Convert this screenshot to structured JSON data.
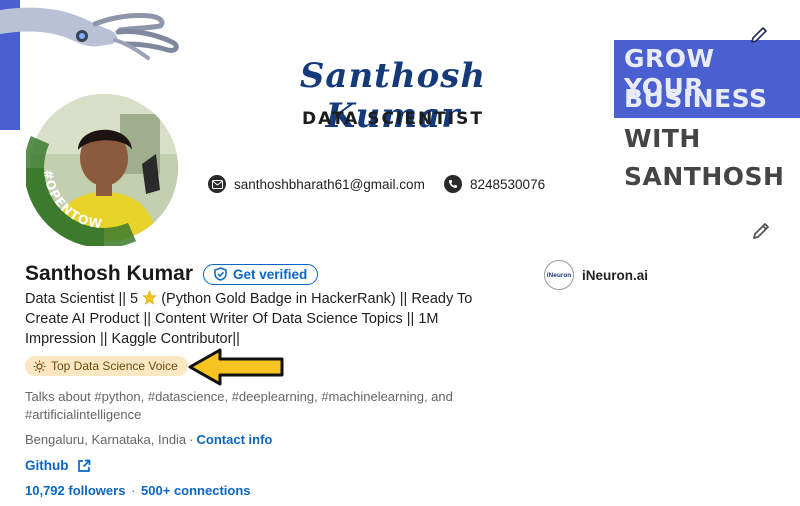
{
  "banner": {
    "name": "Santhosh Kumar",
    "role": "DATA SCIENTIST",
    "email": "santhoshbharath61@gmail.com",
    "phone": "8248530076",
    "promo_lines": [
      "GROW YOUR",
      "BUSINESS",
      "WITH",
      "SANTHOSH"
    ],
    "accent_color": "#4a5fd0"
  },
  "avatar": {
    "ring_text": "#OPENTOWORK",
    "ring_color": "#3c7a2e"
  },
  "profile": {
    "name": "Santhosh Kumar",
    "verify_label": "Get verified",
    "headline_part1": "Data Scientist || 5",
    "headline_part2": "(Python Gold Badge in HackerRank) || Ready To Create AI Product || Content Writer Of Data Science Topics || 1M Impression || Kaggle Contributor||",
    "voice_badge": "Top Data Science Voice",
    "talks_about": "Talks about #python, #datascience, #deeplearning, #machinelearning, and #artificialintelligence",
    "location": "Bengaluru, Karnataka, India",
    "contact_info_label": "Contact info",
    "github_label": "Github",
    "followers": "10,792 followers",
    "connections": "500+ connections",
    "link_color": "#0a66c2"
  },
  "company": {
    "logo_text": "iNeuron",
    "name": "iNeuron.ai"
  },
  "icons": [
    "robot-hand-icon",
    "email-icon",
    "phone-icon",
    "pencil-icon",
    "edit-icon",
    "shield-check-icon",
    "star-icon",
    "lightbulb-icon",
    "arrow-icon",
    "external-link-icon"
  ]
}
